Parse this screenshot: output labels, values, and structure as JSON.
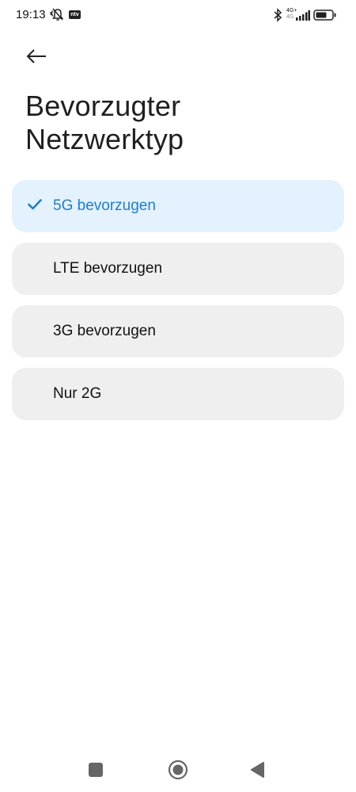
{
  "status_bar": {
    "time": "19:13",
    "ntv_label": "ntv",
    "network_type_top": "4G+",
    "network_type_bottom": "4G"
  },
  "header": {
    "title_line1": "Bevorzugter",
    "title_line2": "Netzwerktyp"
  },
  "options": [
    {
      "label": "5G bevorzugen",
      "selected": true
    },
    {
      "label": "LTE bevorzugen",
      "selected": false
    },
    {
      "label": "3G bevorzugen",
      "selected": false
    },
    {
      "label": "Nur 2G",
      "selected": false
    }
  ],
  "colors": {
    "accent": "#1a7fd7",
    "selected_bg": "#e4f1ff",
    "option_bg": "#efefef"
  },
  "icons": {
    "back": "arrow-left-icon",
    "check": "check-icon",
    "nav_recents": "square-icon",
    "nav_home": "circle-icon",
    "nav_back": "triangle-icon"
  }
}
